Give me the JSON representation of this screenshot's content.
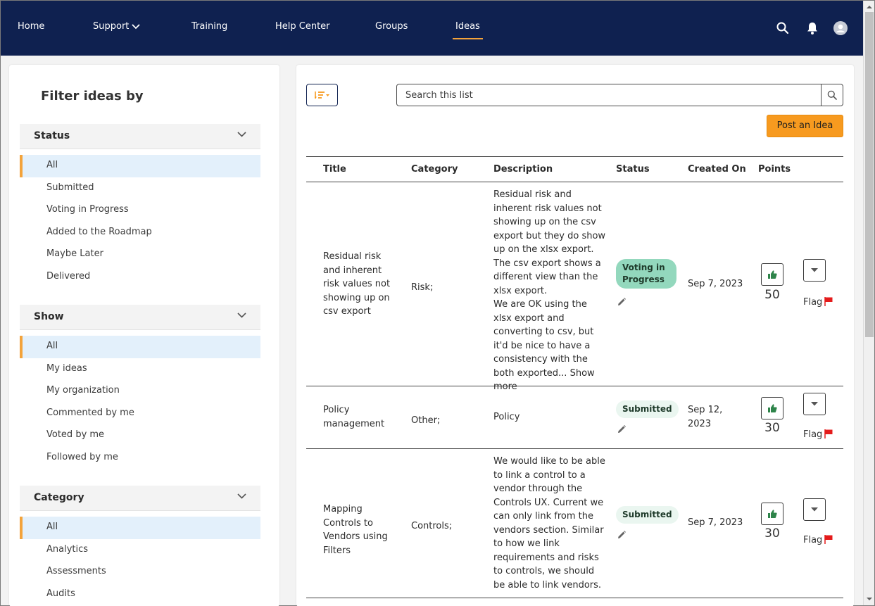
{
  "nav": {
    "items": [
      {
        "label": "Home"
      },
      {
        "label": "Support"
      },
      {
        "label": "Training"
      },
      {
        "label": "Help Center"
      },
      {
        "label": "Groups"
      },
      {
        "label": "Ideas"
      }
    ],
    "active": "Ideas",
    "icons": [
      "search-icon",
      "bell-icon",
      "user-avatar-icon"
    ]
  },
  "colors": {
    "nav_bg": "#0f2150",
    "accent": "#f3a33b",
    "post_button": "#f79a1f",
    "badge_voting": "#93d8bd",
    "badge_submitted": "#eaf6f0",
    "vote_icon": "#2e844a",
    "flag_icon": "#e41b1b",
    "selected_filter_bg": "#e3f0fb"
  },
  "filters": {
    "title": "Filter ideas by",
    "status": {
      "header": "Status",
      "options": [
        "All",
        "Submitted",
        "Voting in Progress",
        "Added to the Roadmap",
        "Maybe Later",
        "Delivered"
      ],
      "selected": "All"
    },
    "show": {
      "header": "Show",
      "options": [
        "All",
        "My ideas",
        "My organization",
        "Commented by me",
        "Voted by me",
        "Followed by me"
      ],
      "selected": "All"
    },
    "category": {
      "header": "Category",
      "options": [
        "All",
        "Analytics",
        "Assessments",
        "Audits"
      ],
      "selected": "All"
    }
  },
  "toolbar": {
    "search_placeholder": "Search this list",
    "post_label": "Post an Idea",
    "sort_icon": "sort-icon"
  },
  "table": {
    "headers": [
      "Title",
      "Category",
      "Description",
      "Status",
      "Created On",
      "Points"
    ],
    "rows": [
      {
        "title": "Residual risk and inherent risk values not showing up on csv export",
        "category": "Risk;",
        "description": "Residual risk and inherent risk values not showing up on the csv export but they do show up on the xlsx export.\nThe csv export shows a different view than the xlsx export.\nWe are OK using the xlsx export and converting to csv, but it'd be nice to have a consistency with the both exported...",
        "show_more": "Show more",
        "status": "Voting in Progress",
        "created": "Sep 7, 2023",
        "points": "50",
        "flag": "Flag"
      },
      {
        "title": "Policy management",
        "category": "Other;",
        "description": "Policy",
        "status": "Submitted",
        "created": "Sep 12, 2023",
        "points": "30",
        "flag": "Flag"
      },
      {
        "title": "Mapping Controls to Vendors using Filters",
        "category": "Controls;",
        "description": "We would like to be able to link a control to a vendor through the Controls UX. Current we can only link from the vendors section. Similar to how we link requirements and risks to controls, we should be able to link vendors.",
        "status": "Submitted",
        "created": "Sep 7, 2023",
        "points": "30",
        "flag": "Flag"
      }
    ]
  }
}
